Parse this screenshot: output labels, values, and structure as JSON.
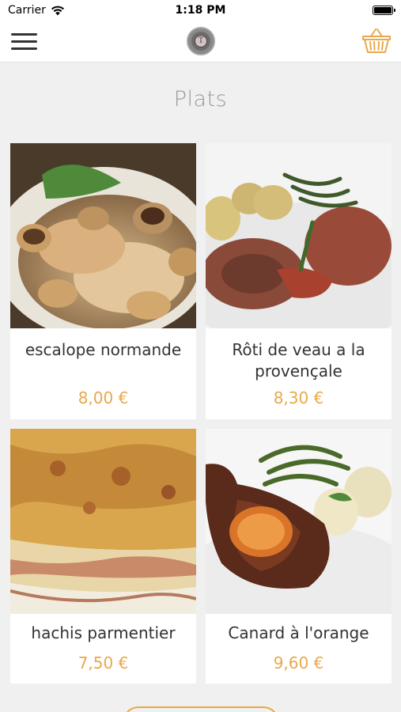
{
  "status_bar": {
    "carrier": "Carrier",
    "time": "1:18 PM"
  },
  "nav": {
    "logo_letter": "T"
  },
  "page": {
    "title": "Plats"
  },
  "products": [
    {
      "name": "escalope normande",
      "price": "8,00 €"
    },
    {
      "name": "Rôti de veau a la provençale",
      "price": "8,30 €"
    },
    {
      "name": "hachis parmentier",
      "price": "7,50 €"
    },
    {
      "name": "Canard à l'orange",
      "price": "9,60 €"
    }
  ],
  "colors": {
    "accent": "#e8a94b",
    "title": "#9a9a9a",
    "background": "#f0f0f0"
  },
  "icons": [
    "hamburger-menu-icon",
    "restaurant-logo",
    "basket-icon",
    "wifi-icon",
    "battery-icon"
  ]
}
